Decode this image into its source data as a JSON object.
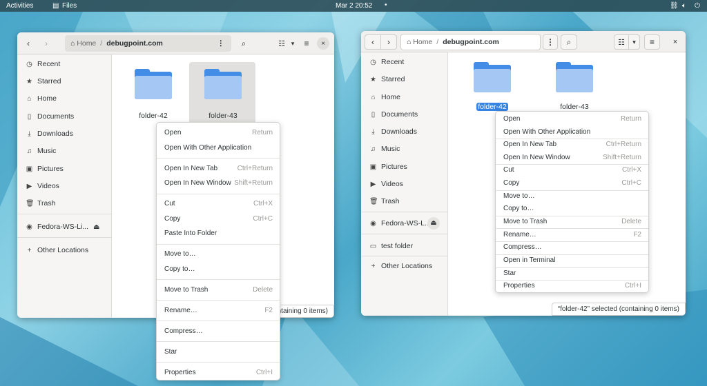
{
  "topbar": {
    "activities": "Activities",
    "app": "Files",
    "clock": "Mar 2  20:52",
    "icons": [
      "network-icon",
      "volume-icon",
      "power-icon"
    ]
  },
  "left_window": {
    "path_home": "Home",
    "path_sep": "/",
    "path_current": "debugpoint.com",
    "sidebar": [
      {
        "icon": "clock-icon",
        "label": "Recent"
      },
      {
        "icon": "star-icon",
        "label": "Starred"
      },
      {
        "icon": "home-icon",
        "label": "Home"
      },
      {
        "icon": "document-icon",
        "label": "Documents"
      },
      {
        "icon": "download-icon",
        "label": "Downloads"
      },
      {
        "icon": "music-icon",
        "label": "Music"
      },
      {
        "icon": "pictures-icon",
        "label": "Pictures"
      },
      {
        "icon": "videos-icon",
        "label": "Videos"
      },
      {
        "icon": "trash-icon",
        "label": "Trash"
      },
      {
        "icon": "disk-icon",
        "label": "Fedora-WS-Li..."
      },
      {
        "icon": "plus-icon",
        "label": "Other Locations"
      }
    ],
    "folders": [
      {
        "name": "folder-42",
        "selected": false
      },
      {
        "name": "folder-43",
        "selected": true
      }
    ],
    "status": "containing 0 items)",
    "menu": [
      [
        {
          "label": "Open",
          "key": "Return"
        },
        {
          "label": "Open With Other Application",
          "key": ""
        }
      ],
      [
        {
          "label": "Open In New Tab",
          "key": "Ctrl+Return"
        },
        {
          "label": "Open In New Window",
          "key": "Shift+Return"
        }
      ],
      [
        {
          "label": "Cut",
          "key": "Ctrl+X"
        },
        {
          "label": "Copy",
          "key": "Ctrl+C"
        },
        {
          "label": "Paste Into Folder",
          "key": ""
        }
      ],
      [
        {
          "label": "Move to…",
          "key": ""
        },
        {
          "label": "Copy to…",
          "key": ""
        }
      ],
      [
        {
          "label": "Move to Trash",
          "key": "Delete"
        }
      ],
      [
        {
          "label": "Rename…",
          "key": "F2"
        }
      ],
      [
        {
          "label": "Compress…",
          "key": ""
        }
      ],
      [
        {
          "label": "Star",
          "key": ""
        }
      ],
      [
        {
          "label": "Properties",
          "key": "Ctrl+I"
        }
      ]
    ]
  },
  "right_window": {
    "path_home": "Home",
    "path_sep": "/",
    "path_current": "debugpoint.com",
    "sidebar": [
      {
        "icon": "clock-icon",
        "label": "Recent"
      },
      {
        "icon": "star-icon",
        "label": "Starred"
      },
      {
        "icon": "home-icon",
        "label": "Home"
      },
      {
        "icon": "document-icon",
        "label": "Documents"
      },
      {
        "icon": "download-icon",
        "label": "Downloads"
      },
      {
        "icon": "music-icon",
        "label": "Music"
      },
      {
        "icon": "pictures-icon",
        "label": "Pictures"
      },
      {
        "icon": "videos-icon",
        "label": "Videos"
      },
      {
        "icon": "trash-icon",
        "label": "Trash"
      },
      {
        "icon": "disk-icon",
        "label": "Fedora-WS-L..."
      },
      {
        "icon": "folder-icon",
        "label": "test folder"
      },
      {
        "icon": "plus-icon",
        "label": "Other Locations"
      }
    ],
    "folders": [
      {
        "name": "folder-42",
        "selected": true
      },
      {
        "name": "folder-43",
        "selected": false
      }
    ],
    "status": "“folder-42” selected  (containing 0 items)",
    "menu": [
      [
        {
          "label": "Open",
          "key": "Return"
        },
        {
          "label": "Open With Other Application",
          "key": ""
        }
      ],
      [
        {
          "label": "Open In New Tab",
          "key": "Ctrl+Return"
        },
        {
          "label": "Open In New Window",
          "key": "Shift+Return"
        }
      ],
      [
        {
          "label": "Cut",
          "key": "Ctrl+X"
        },
        {
          "label": "Copy",
          "key": "Ctrl+C"
        }
      ],
      [
        {
          "label": "Move to…",
          "key": ""
        },
        {
          "label": "Copy to…",
          "key": ""
        }
      ],
      [
        {
          "label": "Move to Trash",
          "key": "Delete"
        }
      ],
      [
        {
          "label": "Rename…",
          "key": "F2"
        }
      ],
      [
        {
          "label": "Compress…",
          "key": ""
        }
      ],
      [
        {
          "label": "Open in Terminal",
          "key": ""
        }
      ],
      [
        {
          "label": "Star",
          "key": ""
        }
      ],
      [
        {
          "label": "Properties",
          "key": "Ctrl+I"
        }
      ]
    ]
  },
  "colors": {
    "accent": "#3584e4",
    "folder": "#438de6",
    "topbar": "#284650"
  }
}
